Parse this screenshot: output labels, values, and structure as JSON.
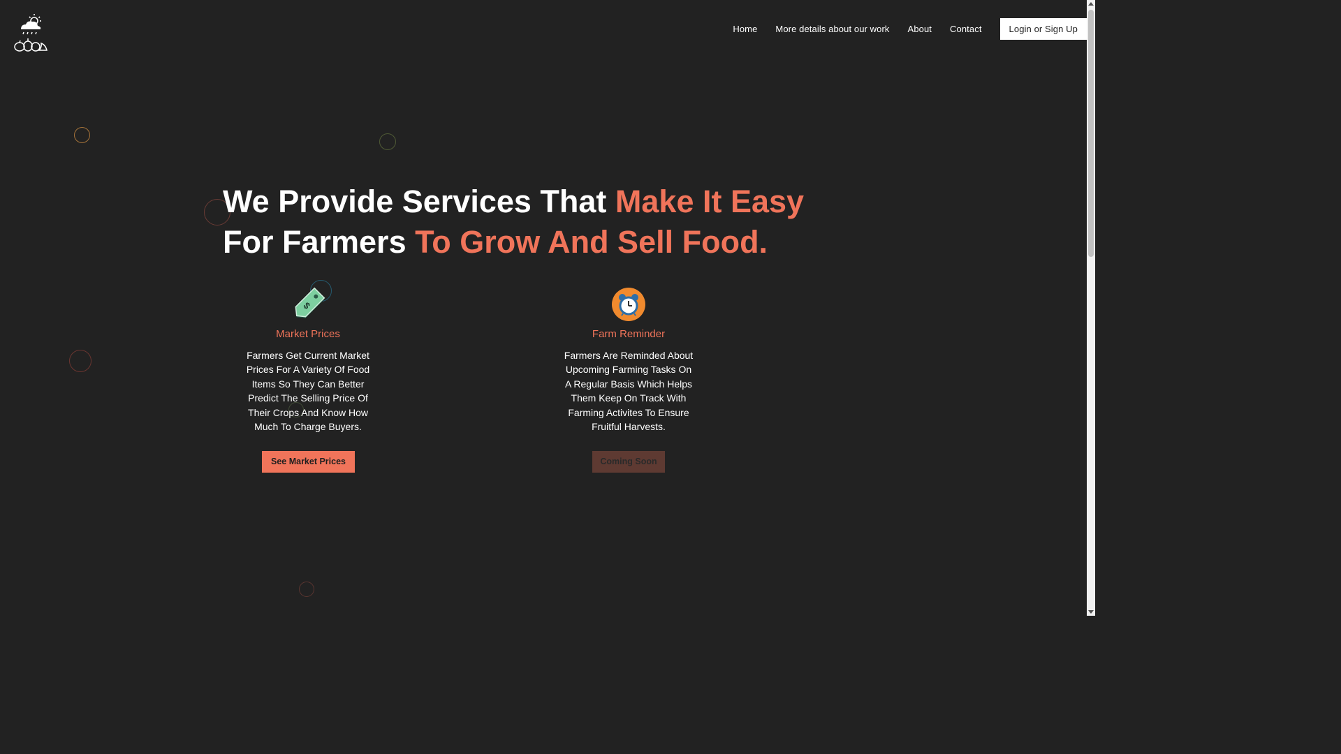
{
  "nav": {
    "home": "Home",
    "details": "More details about our work",
    "about": "About",
    "contact": "Contact",
    "login": "Login or Sign Up"
  },
  "hero": {
    "part1": "We Provide Services That ",
    "accent1": "Make It Easy",
    "part2": " For Farmers ",
    "accent2": "To Grow And Sell Food."
  },
  "services": [
    {
      "title": "Market Prices",
      "description": "Farmers Get Current Market Prices For A Variety Of Food Items So They Can Better Predict The Selling Price Of Their Crops And Know How Much To Charge Buyers.",
      "button": "See Market Prices",
      "icon": "price-tag-icon"
    },
    {
      "title": "Farm Reminder",
      "description": "Farmers Are Reminded About Upcoming Farming Tasks On A Regular Basis Which Helps Them Keep On Track With Farming Activites To Ensure Fruitful Harvests.",
      "button": "Coming Soon",
      "icon": "alarm-clock-icon"
    }
  ],
  "colors": {
    "background": "#222222",
    "accent": "#f0745a",
    "button_disabled": "#5e3a32"
  }
}
